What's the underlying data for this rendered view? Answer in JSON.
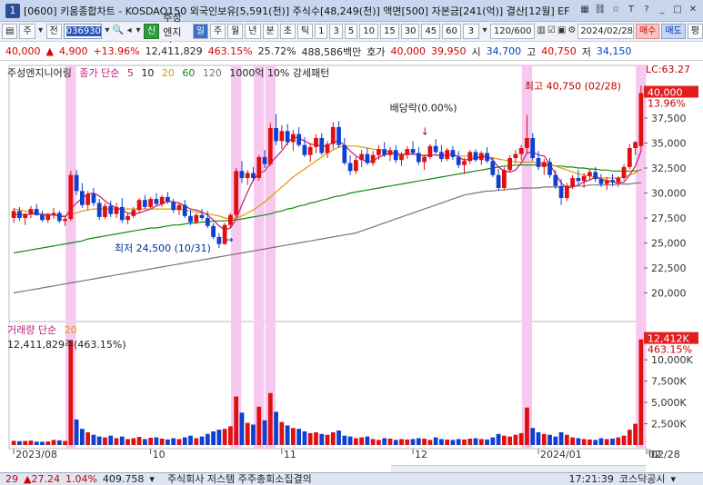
{
  "window": {
    "number": "1",
    "title": "[0600] 키움종합차트 - KOSDAQ150 외국인보유[5,591(천)] 주식수[48,249(천)] 액면[500] 자본금[241(억)] 결산[12월] EF"
  },
  "toolbar": {
    "period_main": "주",
    "period_prev": "전",
    "stock_code": "036930",
    "credit_badge": "신",
    "stock_name": "주성엔지니",
    "periods": [
      "일",
      "주",
      "월",
      "년",
      "분",
      "초",
      "틱"
    ],
    "minutes": [
      "1",
      "3",
      "5",
      "10",
      "15",
      "30",
      "45",
      "60"
    ],
    "count_value": "3",
    "range_value": "120/600",
    "date_value": "2024/02/28",
    "buy_label": "매수",
    "sell_label": "매도",
    "eval_label": "평"
  },
  "quote": {
    "price": "40,000",
    "change": "4,900",
    "change_pct": "+13.96%",
    "volume": "12,411,829",
    "volume_ratio": "463.15%",
    "turnover": "25.72%",
    "amount": "488,586백만",
    "ask_label": "호가",
    "ask": "40,000",
    "bid": "39,950",
    "open_label": "시",
    "open": "34,700",
    "high_label": "고",
    "high": "40,750",
    "low_label": "저",
    "low": "34,150"
  },
  "legend_price": {
    "name": "주성엔지니어링",
    "ma_label": "종가 단순",
    "ma_periods": [
      "5",
      "10",
      "20",
      "60",
      "120"
    ],
    "pattern": "1000억 10% 강세패턴"
  },
  "legend_volume": {
    "label": "거래량 단순",
    "ma": "20",
    "value_text": "12,411,829주(463.15%)"
  },
  "annotations": {
    "high_label": "최고 40,750 (02/28)",
    "low_label": "최저 24,500 (10/31)",
    "dividend_label": "배당락(0.00%)",
    "lc_label": "LC:63.27",
    "current_price_tag": "40,000",
    "current_pct_tag": "13.96%",
    "volume_tag": "12,412K",
    "volume_pct_tag": "463.15%"
  },
  "chart_data": {
    "type": "candlestick",
    "price_axis": {
      "min": 17500,
      "max": 41500,
      "ticks": [
        20000,
        22500,
        25000,
        27500,
        30000,
        32500,
        35000,
        37500
      ],
      "tick_labels": [
        "20,000",
        "22,500",
        "25,000",
        "27,500",
        "30,000",
        "32,500",
        "35,000",
        "37,500"
      ]
    },
    "volume_axis": {
      "min": 0,
      "max": 13000,
      "ticks": [
        2500,
        5000,
        7500,
        10000
      ],
      "tick_labels": [
        "2,500K",
        "5,000K",
        "7,500K",
        "10,000K"
      ]
    },
    "x_labels": [
      "2023/08",
      "10",
      "11",
      "12",
      "2024/01",
      "02",
      "02/28"
    ],
    "highlight_columns": [
      10,
      39,
      43,
      45,
      90,
      110
    ],
    "candles": [
      [
        27500,
        28500,
        27000,
        28200
      ],
      [
        28200,
        28600,
        27200,
        27500
      ],
      [
        27500,
        28000,
        26800,
        27900
      ],
      [
        27900,
        28700,
        27500,
        28400
      ],
      [
        28400,
        28900,
        27700,
        27800
      ],
      [
        27800,
        28200,
        27100,
        27300
      ],
      [
        27300,
        28000,
        27000,
        27800
      ],
      [
        27800,
        28500,
        27400,
        28000
      ],
      [
        28000,
        28200,
        27000,
        27200
      ],
      [
        27200,
        27600,
        26700,
        27400
      ],
      [
        27400,
        32200,
        27200,
        31800
      ],
      [
        31800,
        32300,
        29800,
        30200
      ],
      [
        30200,
        31000,
        28500,
        28800
      ],
      [
        28800,
        30200,
        28300,
        29900
      ],
      [
        29900,
        30500,
        28700,
        29000
      ],
      [
        29000,
        29400,
        27300,
        27600
      ],
      [
        27600,
        29000,
        27400,
        28700
      ],
      [
        28700,
        29200,
        27600,
        27900
      ],
      [
        27900,
        29000,
        27500,
        28600
      ],
      [
        28600,
        29500,
        27000,
        27300
      ],
      [
        27300,
        28000,
        26900,
        27700
      ],
      [
        27700,
        28600,
        27500,
        28300
      ],
      [
        28300,
        29500,
        28000,
        29300
      ],
      [
        29300,
        29800,
        28400,
        28600
      ],
      [
        28600,
        29600,
        28500,
        29400
      ],
      [
        29400,
        30000,
        28700,
        28900
      ],
      [
        28900,
        29800,
        28600,
        29600
      ],
      [
        29600,
        30100,
        28900,
        29100
      ],
      [
        29100,
        29400,
        28000,
        28300
      ],
      [
        28300,
        29000,
        27800,
        28800
      ],
      [
        28800,
        29300,
        27500,
        27700
      ],
      [
        27700,
        28300,
        26800,
        27100
      ],
      [
        27100,
        28000,
        26900,
        27800
      ],
      [
        27800,
        28400,
        27300,
        27500
      ],
      [
        27500,
        28200,
        26500,
        26700
      ],
      [
        26700,
        27000,
        25400,
        25600
      ],
      [
        25600,
        26000,
        24500,
        24900
      ],
      [
        24900,
        27000,
        24800,
        26800
      ],
      [
        26800,
        28000,
        26500,
        27800
      ],
      [
        27800,
        32500,
        27600,
        32200
      ],
      [
        32200,
        33200,
        31000,
        31500
      ],
      [
        31500,
        32300,
        30800,
        32000
      ],
      [
        32000,
        32600,
        31200,
        31500
      ],
      [
        31500,
        33800,
        31200,
        33600
      ],
      [
        33600,
        34300,
        32500,
        32900
      ],
      [
        32900,
        37000,
        32700,
        36500
      ],
      [
        36500,
        37900,
        34800,
        35200
      ],
      [
        35200,
        36800,
        34400,
        36200
      ],
      [
        36200,
        36900,
        34800,
        35100
      ],
      [
        35100,
        36300,
        34200,
        35900
      ],
      [
        35900,
        36600,
        34600,
        34800
      ],
      [
        34800,
        35600,
        33600,
        33800
      ],
      [
        33800,
        35000,
        33100,
        34600
      ],
      [
        34600,
        35900,
        34000,
        35500
      ],
      [
        35500,
        36000,
        33800,
        34000
      ],
      [
        34000,
        35200,
        33500,
        34900
      ],
      [
        34900,
        37100,
        34400,
        36600
      ],
      [
        36600,
        37200,
        34500,
        34800
      ],
      [
        34800,
        35500,
        32800,
        33000
      ],
      [
        33000,
        33800,
        31800,
        32200
      ],
      [
        32200,
        33600,
        31900,
        33300
      ],
      [
        33300,
        34300,
        32600,
        33900
      ],
      [
        33900,
        34500,
        32800,
        33000
      ],
      [
        33000,
        34200,
        32700,
        33800
      ],
      [
        33800,
        34800,
        33300,
        34400
      ],
      [
        34400,
        35100,
        33600,
        33800
      ],
      [
        33800,
        34600,
        33200,
        34300
      ],
      [
        34300,
        34800,
        33000,
        33300
      ],
      [
        33300,
        34100,
        32700,
        33800
      ],
      [
        33800,
        34700,
        33400,
        34400
      ],
      [
        34400,
        35200,
        33800,
        34000
      ],
      [
        34000,
        34600,
        32800,
        33100
      ],
      [
        33100,
        33800,
        32300,
        33600
      ],
      [
        33600,
        34900,
        33400,
        34700
      ],
      [
        34700,
        35400,
        33900,
        34100
      ],
      [
        34100,
        34800,
        33100,
        33400
      ],
      [
        33400,
        34500,
        33200,
        34300
      ],
      [
        34300,
        34700,
        33300,
        33600
      ],
      [
        33600,
        34200,
        32500,
        32800
      ],
      [
        32800,
        33500,
        31900,
        33200
      ],
      [
        33200,
        34300,
        32900,
        34100
      ],
      [
        34100,
        34400,
        33100,
        33300
      ],
      [
        33300,
        34200,
        32800,
        34000
      ],
      [
        34000,
        34600,
        33000,
        33200
      ],
      [
        33200,
        33600,
        31600,
        31800
      ],
      [
        31800,
        32400,
        30200,
        30500
      ],
      [
        30500,
        32600,
        30300,
        32300
      ],
      [
        32300,
        33800,
        32100,
        33500
      ],
      [
        33500,
        34300,
        33000,
        33900
      ],
      [
        33900,
        34800,
        33300,
        34500
      ],
      [
        34500,
        37800,
        34000,
        35500
      ],
      [
        35500,
        36000,
        33200,
        33500
      ],
      [
        33500,
        34200,
        32300,
        32600
      ],
      [
        32600,
        33400,
        31800,
        33100
      ],
      [
        33100,
        33500,
        31500,
        31800
      ],
      [
        31800,
        32300,
        30400,
        30700
      ],
      [
        30700,
        31400,
        28800,
        29500
      ],
      [
        29500,
        31000,
        29200,
        30700
      ],
      [
        30700,
        31800,
        30400,
        31500
      ],
      [
        31500,
        32300,
        30900,
        31200
      ],
      [
        31200,
        32000,
        30500,
        31700
      ],
      [
        31700,
        32400,
        31300,
        32100
      ],
      [
        32100,
        32600,
        31100,
        31400
      ],
      [
        31400,
        31900,
        30600,
        30900
      ],
      [
        30900,
        31600,
        30300,
        31300
      ],
      [
        31300,
        31900,
        30700,
        31100
      ],
      [
        31100,
        31700,
        30600,
        31500
      ],
      [
        31500,
        32900,
        31300,
        32600
      ],
      [
        32600,
        34900,
        32400,
        34500
      ],
      [
        34500,
        35200,
        33800,
        35100
      ],
      [
        34700,
        40750,
        34150,
        40000
      ]
    ],
    "ma5": [
      27800,
      27900,
      27800,
      27900,
      27900,
      27800,
      27800,
      27800,
      27700,
      27600,
      28400,
      29000,
      29500,
      29900,
      30000,
      29700,
      29200,
      28800,
      28500,
      28300,
      28000,
      27900,
      28000,
      28200,
      28400,
      28700,
      28900,
      29200,
      29100,
      29000,
      28700,
      28400,
      28300,
      28100,
      27800,
      27300,
      26700,
      26300,
      26500,
      27400,
      28800,
      30100,
      31300,
      32000,
      32200,
      33000,
      33600,
      34200,
      35000,
      35600,
      35500,
      35200,
      34900,
      34800,
      34700,
      34700,
      35100,
      35200,
      34800,
      34200,
      33700,
      33400,
      33100,
      33200,
      33600,
      33800,
      34000,
      33900,
      33800,
      33900,
      33900,
      33800,
      33700,
      33800,
      33800,
      33700,
      33800,
      33900,
      33600,
      33300,
      33400,
      33500,
      33600,
      33700,
      33300,
      32600,
      32200,
      32100,
      32300,
      33000,
      34000,
      34100,
      33800,
      33700,
      32900,
      31900,
      31000,
      30500,
      30600,
      30800,
      31100,
      31300,
      31600,
      31400,
      31200,
      31100,
      31000,
      31100,
      31800,
      32700,
      34200
    ],
    "ma20": [
      28400,
      28300,
      28200,
      28100,
      28000,
      27900,
      27900,
      27800,
      27800,
      27700,
      27900,
      28000,
      28200,
      28300,
      28400,
      28400,
      28400,
      28400,
      28400,
      28400,
      28400,
      28400,
      28400,
      28400,
      28400,
      28400,
      28400,
      28400,
      28400,
      28400,
      28300,
      28200,
      28100,
      28000,
      27900,
      27800,
      27700,
      27500,
      27400,
      27500,
      27700,
      28000,
      28300,
      28700,
      29100,
      29600,
      30100,
      30600,
      31100,
      31600,
      32000,
      32400,
      32800,
      33200,
      33600,
      34000,
      34300,
      34600,
      34700,
      34700,
      34700,
      34600,
      34500,
      34400,
      34300,
      34200,
      34100,
      34000,
      33900,
      33900,
      33900,
      33800,
      33800,
      33800,
      33800,
      33800,
      33800,
      33800,
      33700,
      33700,
      33700,
      33600,
      33600,
      33600,
      33500,
      33400,
      33300,
      33200,
      33100,
      33100,
      33100,
      33100,
      33000,
      33000,
      32900,
      32700,
      32500,
      32300,
      32100,
      31900,
      31800,
      31700,
      31600,
      31500,
      31500,
      31500,
      31500,
      31600,
      31800,
      32000,
      32400
    ],
    "ma60": [
      24000,
      24100,
      24200,
      24300,
      24400,
      24500,
      24600,
      24700,
      24800,
      24900,
      25000,
      25100,
      25200,
      25400,
      25500,
      25600,
      25700,
      25800,
      25900,
      26000,
      26100,
      26200,
      26300,
      26400,
      26500,
      26500,
      26600,
      26700,
      26800,
      26800,
      26900,
      27000,
      27000,
      27100,
      27100,
      27200,
      27200,
      27200,
      27300,
      27300,
      27400,
      27500,
      27600,
      27700,
      27800,
      27900,
      28100,
      28200,
      28400,
      28500,
      28700,
      28800,
      29000,
      29100,
      29300,
      29400,
      29600,
      29700,
      29800,
      30000,
      30100,
      30200,
      30300,
      30400,
      30500,
      30600,
      30700,
      30800,
      30900,
      31000,
      31100,
      31200,
      31300,
      31400,
      31500,
      31600,
      31700,
      31800,
      31900,
      32000,
      32100,
      32200,
      32300,
      32400,
      32500,
      32600,
      32700,
      32700,
      32800,
      32800,
      32800,
      32800,
      32800,
      32800,
      32800,
      32700,
      32700,
      32600,
      32600,
      32500,
      32500,
      32400,
      32400,
      32300,
      32300,
      32200,
      32200,
      32200,
      32200,
      32200,
      32300
    ],
    "ma120": [
      20000,
      20100,
      20200,
      20300,
      20400,
      20500,
      20600,
      20700,
      20800,
      20900,
      21000,
      21100,
      21200,
      21300,
      21400,
      21500,
      21600,
      21700,
      21800,
      21900,
      22000,
      22100,
      22200,
      22300,
      22400,
      22500,
      22600,
      22700,
      22800,
      22900,
      23000,
      23100,
      23200,
      23300,
      23400,
      23500,
      23600,
      23700,
      23800,
      23900,
      24000,
      24100,
      24200,
      24300,
      24400,
      24500,
      24600,
      24700,
      24800,
      24900,
      25000,
      25100,
      25200,
      25300,
      25400,
      25500,
      25600,
      25700,
      25800,
      25900,
      26000,
      26200,
      26400,
      26600,
      26800,
      27000,
      27200,
      27400,
      27600,
      27800,
      28000,
      28200,
      28400,
      28600,
      28800,
      29000,
      29200,
      29400,
      29600,
      29800,
      29900,
      30000,
      30100,
      30200,
      30200,
      30300,
      30300,
      30400,
      30400,
      30500,
      30500,
      30500,
      30500,
      30600,
      30600,
      30600,
      30600,
      30700,
      30700,
      30700,
      30700,
      30800,
      30800,
      30800,
      30800,
      30800,
      30900,
      30900,
      30900,
      31000,
      31000
    ],
    "volume": [
      500,
      450,
      480,
      520,
      400,
      380,
      420,
      600,
      550,
      480,
      12300,
      3000,
      1900,
      1500,
      1200,
      1000,
      900,
      1100,
      800,
      1000,
      700,
      800,
      950,
      700,
      850,
      900,
      750,
      650,
      800,
      700,
      900,
      1100,
      800,
      1000,
      1300,
      1600,
      1800,
      1900,
      2200,
      5700,
      3800,
      2600,
      2400,
      4500,
      2900,
      6100,
      3900,
      2700,
      2300,
      2000,
      1900,
      1600,
      1400,
      1500,
      1300,
      1200,
      1500,
      1700,
      1100,
      1000,
      800,
      900,
      1000,
      700,
      600,
      800,
      750,
      600,
      700,
      650,
      700,
      800,
      750,
      600,
      900,
      700,
      650,
      600,
      700,
      650,
      750,
      800,
      700,
      650,
      900,
      1300,
      1100,
      1000,
      1200,
      1400,
      4400,
      2000,
      1500,
      1300,
      1200,
      1000,
      1500,
      1200,
      900,
      800,
      700,
      650,
      600,
      800,
      700,
      750,
      900,
      1100,
      1800,
      2500,
      12400
    ]
  },
  "status": {
    "index_value": "29",
    "index_change": "▲27.24",
    "index_pct": "1.04%",
    "index_level": "409.758",
    "news": "주식회사 저스템 주주총회소집결의",
    "time": "17:21:39",
    "market": "코스닥공시"
  }
}
